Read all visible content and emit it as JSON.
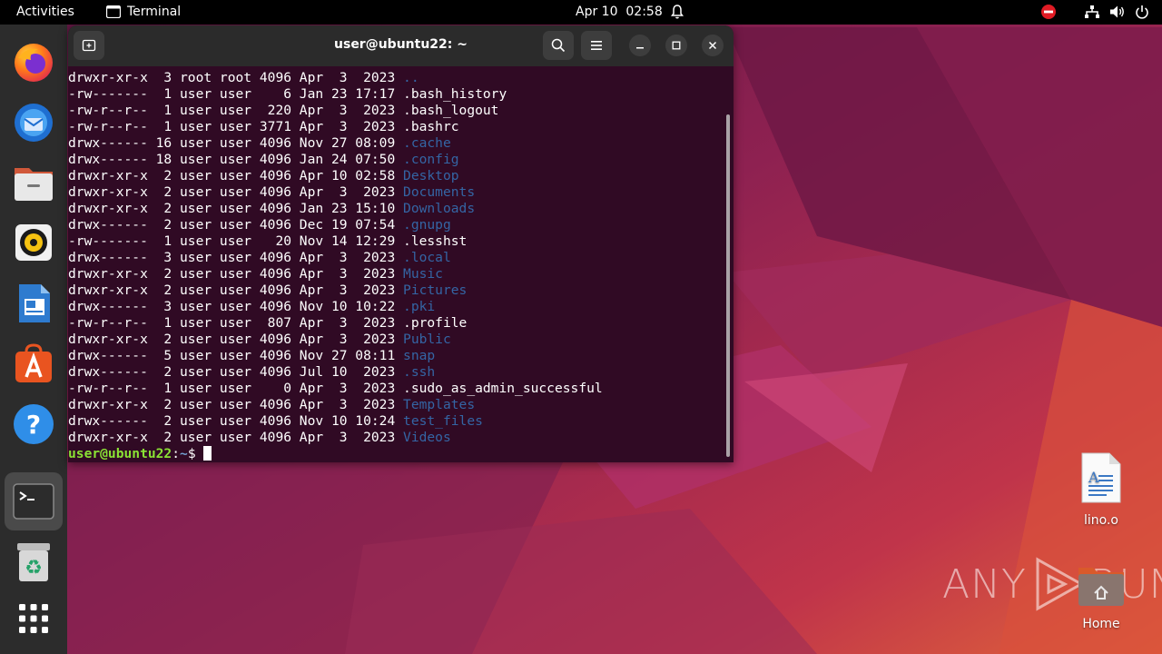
{
  "topbar": {
    "activities": "Activities",
    "app_name": "Terminal",
    "clock": "Apr 10  02:58"
  },
  "dock": {
    "items": [
      "firefox-icon",
      "thunderbird-icon",
      "files-icon",
      "rhythmbox-icon",
      "writer-icon",
      "app-center-icon",
      "help-icon",
      "terminal-icon",
      "trash-icon",
      "show-apps-icon"
    ]
  },
  "terminal": {
    "title": "user@ubuntu22: ~",
    "lines": [
      {
        "meta": "drwxr-xr-x  3 root root 4096 Apr  3  2023 ",
        "name": "..",
        "dir": true
      },
      {
        "meta": "-rw-------  1 user user    6 Jan 23 17:17 ",
        "name": ".bash_history",
        "dir": false
      },
      {
        "meta": "-rw-r--r--  1 user user  220 Apr  3  2023 ",
        "name": ".bash_logout",
        "dir": false
      },
      {
        "meta": "-rw-r--r--  1 user user 3771 Apr  3  2023 ",
        "name": ".bashrc",
        "dir": false
      },
      {
        "meta": "drwx------ 16 user user 4096 Nov 27 08:09 ",
        "name": ".cache",
        "dir": true
      },
      {
        "meta": "drwx------ 18 user user 4096 Jan 24 07:50 ",
        "name": ".config",
        "dir": true
      },
      {
        "meta": "drwxr-xr-x  2 user user 4096 Apr 10 02:58 ",
        "name": "Desktop",
        "dir": true
      },
      {
        "meta": "drwxr-xr-x  2 user user 4096 Apr  3  2023 ",
        "name": "Documents",
        "dir": true
      },
      {
        "meta": "drwxr-xr-x  2 user user 4096 Jan 23 15:10 ",
        "name": "Downloads",
        "dir": true
      },
      {
        "meta": "drwx------  2 user user 4096 Dec 19 07:54 ",
        "name": ".gnupg",
        "dir": true
      },
      {
        "meta": "-rw-------  1 user user   20 Nov 14 12:29 ",
        "name": ".lesshst",
        "dir": false
      },
      {
        "meta": "drwx------  3 user user 4096 Apr  3  2023 ",
        "name": ".local",
        "dir": true
      },
      {
        "meta": "drwxr-xr-x  2 user user 4096 Apr  3  2023 ",
        "name": "Music",
        "dir": true
      },
      {
        "meta": "drwxr-xr-x  2 user user 4096 Apr  3  2023 ",
        "name": "Pictures",
        "dir": true
      },
      {
        "meta": "drwx------  3 user user 4096 Nov 10 10:22 ",
        "name": ".pki",
        "dir": true
      },
      {
        "meta": "-rw-r--r--  1 user user  807 Apr  3  2023 ",
        "name": ".profile",
        "dir": false
      },
      {
        "meta": "drwxr-xr-x  2 user user 4096 Apr  3  2023 ",
        "name": "Public",
        "dir": true
      },
      {
        "meta": "drwx------  5 user user 4096 Nov 27 08:11 ",
        "name": "snap",
        "dir": true
      },
      {
        "meta": "drwx------  2 user user 4096 Jul 10  2023 ",
        "name": ".ssh",
        "dir": true
      },
      {
        "meta": "-rw-r--r--  1 user user    0 Apr  3  2023 ",
        "name": ".sudo_as_admin_successful",
        "dir": false
      },
      {
        "meta": "drwxr-xr-x  2 user user 4096 Apr  3  2023 ",
        "name": "Templates",
        "dir": true
      },
      {
        "meta": "drwx------  2 user user 4096 Nov 10 10:24 ",
        "name": "test_files",
        "dir": true
      },
      {
        "meta": "drwxr-xr-x  2 user user 4096 Apr  3  2023 ",
        "name": "Videos",
        "dir": true
      }
    ],
    "prompt_user": "user@ubuntu22",
    "prompt_sep": ":",
    "prompt_path": "~",
    "prompt_symbol": "$ "
  },
  "desktop": {
    "file_label": "lino.o",
    "home_label": "Home"
  },
  "watermark": {
    "left": "ANY",
    "right": "RUN"
  },
  "colors": {
    "terminal_bg": "#300a24",
    "dir_blue": "#3465a4",
    "prompt_green": "#8ae234",
    "prompt_path": "#729fcf",
    "dock_bg": "#2c2c2c",
    "accent": "#e95420"
  }
}
